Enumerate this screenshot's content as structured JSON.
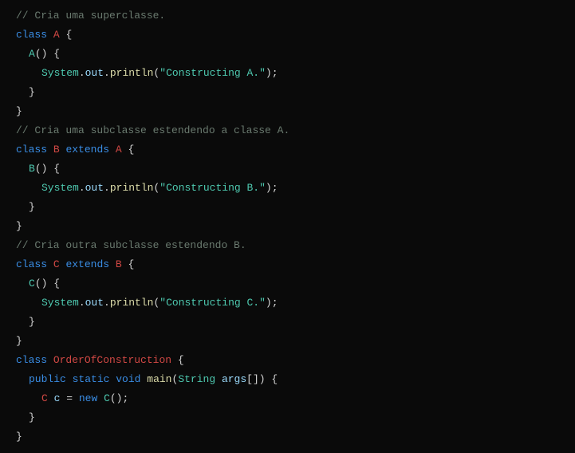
{
  "code": {
    "lines": [
      {
        "indent": 0,
        "tokens": [
          {
            "t": "// Cria uma superclasse.",
            "c": "comment"
          }
        ]
      },
      {
        "indent": 0,
        "tokens": [
          {
            "t": "class",
            "c": "keyword"
          },
          {
            "t": " "
          },
          {
            "t": "A",
            "c": "class"
          },
          {
            "t": " {",
            "c": "punc"
          }
        ]
      },
      {
        "indent": 1,
        "tokens": [
          {
            "t": "A",
            "c": "type"
          },
          {
            "t": "() {",
            "c": "punc"
          }
        ]
      },
      {
        "indent": 2,
        "tokens": [
          {
            "t": "System",
            "c": "type"
          },
          {
            "t": ".",
            "c": "punc"
          },
          {
            "t": "out",
            "c": "var"
          },
          {
            "t": ".",
            "c": "punc"
          },
          {
            "t": "println",
            "c": "method"
          },
          {
            "t": "(",
            "c": "punc"
          },
          {
            "t": "\"Constructing A.\"",
            "c": "string"
          },
          {
            "t": ");",
            "c": "punc"
          }
        ]
      },
      {
        "indent": 1,
        "tokens": [
          {
            "t": "}",
            "c": "punc"
          }
        ]
      },
      {
        "indent": 0,
        "tokens": [
          {
            "t": "}",
            "c": "punc"
          }
        ]
      },
      {
        "indent": 0,
        "tokens": [
          {
            "t": "// Cria uma subclasse estendendo a classe A.",
            "c": "comment"
          }
        ]
      },
      {
        "indent": 0,
        "tokens": [
          {
            "t": "class",
            "c": "keyword"
          },
          {
            "t": " "
          },
          {
            "t": "B",
            "c": "class"
          },
          {
            "t": " "
          },
          {
            "t": "extends",
            "c": "keyword"
          },
          {
            "t": " "
          },
          {
            "t": "A",
            "c": "class"
          },
          {
            "t": " {",
            "c": "punc"
          }
        ]
      },
      {
        "indent": 1,
        "tokens": [
          {
            "t": "B",
            "c": "type"
          },
          {
            "t": "() {",
            "c": "punc"
          }
        ]
      },
      {
        "indent": 2,
        "tokens": [
          {
            "t": "System",
            "c": "type"
          },
          {
            "t": ".",
            "c": "punc"
          },
          {
            "t": "out",
            "c": "var"
          },
          {
            "t": ".",
            "c": "punc"
          },
          {
            "t": "println",
            "c": "method"
          },
          {
            "t": "(",
            "c": "punc"
          },
          {
            "t": "\"Constructing B.\"",
            "c": "string"
          },
          {
            "t": ");",
            "c": "punc"
          }
        ]
      },
      {
        "indent": 1,
        "tokens": [
          {
            "t": "}",
            "c": "punc"
          }
        ]
      },
      {
        "indent": 0,
        "tokens": [
          {
            "t": "}",
            "c": "punc"
          }
        ]
      },
      {
        "indent": 0,
        "tokens": [
          {
            "t": "// Cria outra subclasse estendendo B.",
            "c": "comment"
          }
        ]
      },
      {
        "indent": 0,
        "tokens": [
          {
            "t": "class",
            "c": "keyword"
          },
          {
            "t": " "
          },
          {
            "t": "C",
            "c": "class"
          },
          {
            "t": " "
          },
          {
            "t": "extends",
            "c": "keyword"
          },
          {
            "t": " "
          },
          {
            "t": "B",
            "c": "class"
          },
          {
            "t": " {",
            "c": "punc"
          }
        ]
      },
      {
        "indent": 1,
        "tokens": [
          {
            "t": "C",
            "c": "type"
          },
          {
            "t": "() {",
            "c": "punc"
          }
        ]
      },
      {
        "indent": 2,
        "tokens": [
          {
            "t": "System",
            "c": "type"
          },
          {
            "t": ".",
            "c": "punc"
          },
          {
            "t": "out",
            "c": "var"
          },
          {
            "t": ".",
            "c": "punc"
          },
          {
            "t": "println",
            "c": "method"
          },
          {
            "t": "(",
            "c": "punc"
          },
          {
            "t": "\"Constructing C.\"",
            "c": "string"
          },
          {
            "t": ");",
            "c": "punc"
          }
        ]
      },
      {
        "indent": 1,
        "tokens": [
          {
            "t": "}",
            "c": "punc"
          }
        ]
      },
      {
        "indent": 0,
        "tokens": [
          {
            "t": "}",
            "c": "punc"
          }
        ]
      },
      {
        "indent": 0,
        "tokens": [
          {
            "t": "class",
            "c": "keyword"
          },
          {
            "t": " "
          },
          {
            "t": "OrderOfConstruction",
            "c": "class"
          },
          {
            "t": " {",
            "c": "punc"
          }
        ]
      },
      {
        "indent": 1,
        "tokens": [
          {
            "t": "public",
            "c": "keyword"
          },
          {
            "t": " "
          },
          {
            "t": "static",
            "c": "keyword"
          },
          {
            "t": " "
          },
          {
            "t": "void",
            "c": "keyword"
          },
          {
            "t": " "
          },
          {
            "t": "main",
            "c": "method"
          },
          {
            "t": "(",
            "c": "punc"
          },
          {
            "t": "String",
            "c": "type"
          },
          {
            "t": " "
          },
          {
            "t": "args",
            "c": "var"
          },
          {
            "t": "[]) {",
            "c": "punc"
          }
        ]
      },
      {
        "indent": 2,
        "tokens": [
          {
            "t": "C",
            "c": "class"
          },
          {
            "t": " "
          },
          {
            "t": "c",
            "c": "var"
          },
          {
            "t": " = ",
            "c": "punc"
          },
          {
            "t": "new",
            "c": "keyword"
          },
          {
            "t": " "
          },
          {
            "t": "C",
            "c": "type"
          },
          {
            "t": "();",
            "c": "punc"
          }
        ]
      },
      {
        "indent": 1,
        "tokens": [
          {
            "t": "}",
            "c": "punc"
          }
        ]
      },
      {
        "indent": 0,
        "tokens": [
          {
            "t": "}",
            "c": "punc"
          }
        ]
      }
    ]
  }
}
